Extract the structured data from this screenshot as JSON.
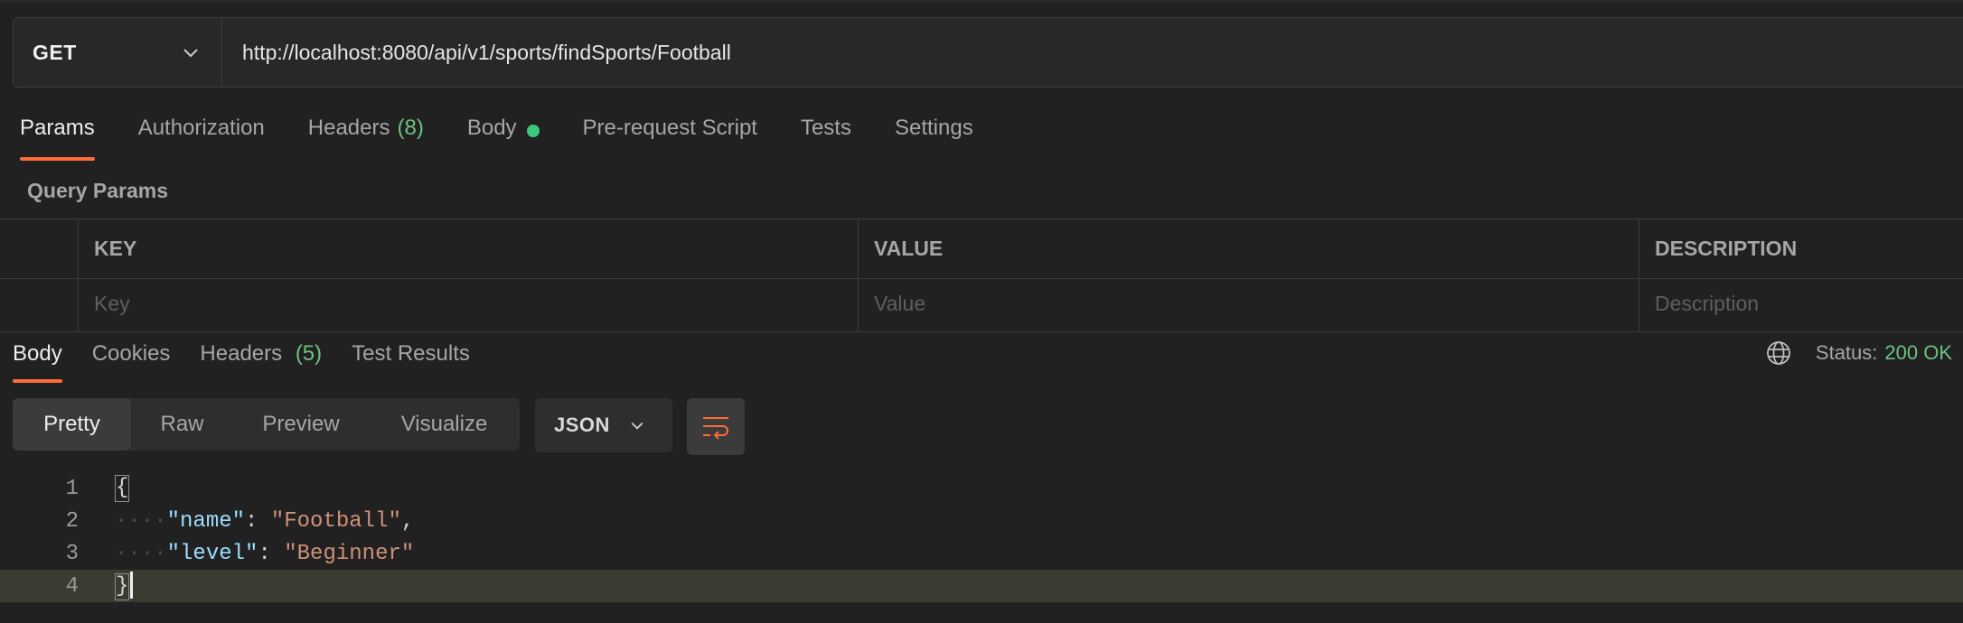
{
  "request": {
    "method": "GET",
    "url": "http://localhost:8080/api/v1/sports/findSports/Football"
  },
  "request_tabs": [
    {
      "label": "Params",
      "active": true
    },
    {
      "label": "Authorization"
    },
    {
      "label": "Headers",
      "count": "(8)"
    },
    {
      "label": "Body",
      "indicator": "green-dot"
    },
    {
      "label": "Pre-request Script"
    },
    {
      "label": "Tests"
    },
    {
      "label": "Settings"
    }
  ],
  "query_params": {
    "title": "Query Params",
    "columns": [
      "KEY",
      "VALUE",
      "DESCRIPTION"
    ],
    "placeholders": [
      "Key",
      "Value",
      "Description"
    ]
  },
  "response_tabs": [
    {
      "label": "Body",
      "active": true
    },
    {
      "label": "Cookies"
    },
    {
      "label": "Headers",
      "count": "(5)"
    },
    {
      "label": "Test Results"
    }
  ],
  "status": {
    "label": "Status:",
    "value": "200 OK",
    "icon": "globe-icon"
  },
  "format": {
    "modes": [
      "Pretty",
      "Raw",
      "Preview",
      "Visualize"
    ],
    "active_mode": "Pretty",
    "language": "JSON",
    "wrap_icon": "wrap-lines-icon"
  },
  "editor": {
    "line_numbers": [
      "1",
      "2",
      "3",
      "4"
    ],
    "open_brace": "{",
    "close_brace": "}",
    "indent": "····",
    "fields": [
      {
        "key": "\"name\"",
        "value": "\"Football\"",
        "trailing": ","
      },
      {
        "key": "\"level\"",
        "value": "\"Beginner\"",
        "trailing": ""
      }
    ]
  },
  "colors": {
    "accent": "#ff6c37",
    "success": "#6cc280",
    "background": "#212121"
  }
}
